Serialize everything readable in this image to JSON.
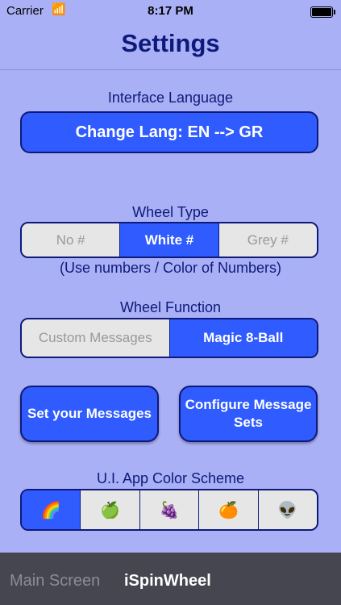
{
  "status": {
    "carrier": "Carrier",
    "time": "8:17 PM",
    "battery_level": 1.0
  },
  "navbar": {
    "title": "Settings"
  },
  "language": {
    "label": "Interface Language",
    "button": "Change Lang: EN --> GR"
  },
  "wheel_type": {
    "label": "Wheel Type",
    "options": [
      "No #",
      "White #",
      "Grey #"
    ],
    "selected": 1,
    "hint": "(Use numbers / Color of Numbers)"
  },
  "wheel_function": {
    "label": "Wheel Function",
    "options": [
      "Custom Messages",
      "Magic 8-Ball"
    ],
    "selected": 1
  },
  "buttons": {
    "set_messages": "Set your Messages",
    "configure_sets": "Configure Message Sets"
  },
  "color_scheme": {
    "label": "U.I. App Color Scheme",
    "options": [
      "🌈",
      "🍏",
      "🍇",
      "🍊",
      "👽"
    ],
    "selected": 0
  },
  "tabbar": {
    "tab_main": "Main Screen",
    "tab_app": "iSpinWheel"
  },
  "colors": {
    "background": "#aab0f5",
    "accent": "#2f5bff",
    "text": "#0d1a7a",
    "tabbar": "#45464f"
  }
}
